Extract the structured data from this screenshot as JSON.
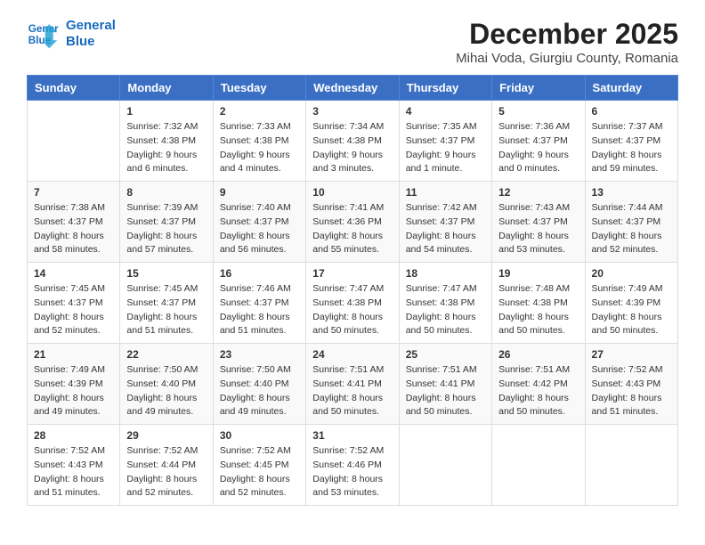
{
  "logo": {
    "line1": "General",
    "line2": "Blue"
  },
  "title": "December 2025",
  "subtitle": "Mihai Voda, Giurgiu County, Romania",
  "days_of_week": [
    "Sunday",
    "Monday",
    "Tuesday",
    "Wednesday",
    "Thursday",
    "Friday",
    "Saturday"
  ],
  "weeks": [
    [
      {
        "day": "",
        "info": ""
      },
      {
        "day": "1",
        "info": "Sunrise: 7:32 AM\nSunset: 4:38 PM\nDaylight: 9 hours\nand 6 minutes."
      },
      {
        "day": "2",
        "info": "Sunrise: 7:33 AM\nSunset: 4:38 PM\nDaylight: 9 hours\nand 4 minutes."
      },
      {
        "day": "3",
        "info": "Sunrise: 7:34 AM\nSunset: 4:38 PM\nDaylight: 9 hours\nand 3 minutes."
      },
      {
        "day": "4",
        "info": "Sunrise: 7:35 AM\nSunset: 4:37 PM\nDaylight: 9 hours\nand 1 minute."
      },
      {
        "day": "5",
        "info": "Sunrise: 7:36 AM\nSunset: 4:37 PM\nDaylight: 9 hours\nand 0 minutes."
      },
      {
        "day": "6",
        "info": "Sunrise: 7:37 AM\nSunset: 4:37 PM\nDaylight: 8 hours\nand 59 minutes."
      }
    ],
    [
      {
        "day": "7",
        "info": "Sunrise: 7:38 AM\nSunset: 4:37 PM\nDaylight: 8 hours\nand 58 minutes."
      },
      {
        "day": "8",
        "info": "Sunrise: 7:39 AM\nSunset: 4:37 PM\nDaylight: 8 hours\nand 57 minutes."
      },
      {
        "day": "9",
        "info": "Sunrise: 7:40 AM\nSunset: 4:37 PM\nDaylight: 8 hours\nand 56 minutes."
      },
      {
        "day": "10",
        "info": "Sunrise: 7:41 AM\nSunset: 4:36 PM\nDaylight: 8 hours\nand 55 minutes."
      },
      {
        "day": "11",
        "info": "Sunrise: 7:42 AM\nSunset: 4:37 PM\nDaylight: 8 hours\nand 54 minutes."
      },
      {
        "day": "12",
        "info": "Sunrise: 7:43 AM\nSunset: 4:37 PM\nDaylight: 8 hours\nand 53 minutes."
      },
      {
        "day": "13",
        "info": "Sunrise: 7:44 AM\nSunset: 4:37 PM\nDaylight: 8 hours\nand 52 minutes."
      }
    ],
    [
      {
        "day": "14",
        "info": "Sunrise: 7:45 AM\nSunset: 4:37 PM\nDaylight: 8 hours\nand 52 minutes."
      },
      {
        "day": "15",
        "info": "Sunrise: 7:45 AM\nSunset: 4:37 PM\nDaylight: 8 hours\nand 51 minutes."
      },
      {
        "day": "16",
        "info": "Sunrise: 7:46 AM\nSunset: 4:37 PM\nDaylight: 8 hours\nand 51 minutes."
      },
      {
        "day": "17",
        "info": "Sunrise: 7:47 AM\nSunset: 4:38 PM\nDaylight: 8 hours\nand 50 minutes."
      },
      {
        "day": "18",
        "info": "Sunrise: 7:47 AM\nSunset: 4:38 PM\nDaylight: 8 hours\nand 50 minutes."
      },
      {
        "day": "19",
        "info": "Sunrise: 7:48 AM\nSunset: 4:38 PM\nDaylight: 8 hours\nand 50 minutes."
      },
      {
        "day": "20",
        "info": "Sunrise: 7:49 AM\nSunset: 4:39 PM\nDaylight: 8 hours\nand 50 minutes."
      }
    ],
    [
      {
        "day": "21",
        "info": "Sunrise: 7:49 AM\nSunset: 4:39 PM\nDaylight: 8 hours\nand 49 minutes."
      },
      {
        "day": "22",
        "info": "Sunrise: 7:50 AM\nSunset: 4:40 PM\nDaylight: 8 hours\nand 49 minutes."
      },
      {
        "day": "23",
        "info": "Sunrise: 7:50 AM\nSunset: 4:40 PM\nDaylight: 8 hours\nand 49 minutes."
      },
      {
        "day": "24",
        "info": "Sunrise: 7:51 AM\nSunset: 4:41 PM\nDaylight: 8 hours\nand 50 minutes."
      },
      {
        "day": "25",
        "info": "Sunrise: 7:51 AM\nSunset: 4:41 PM\nDaylight: 8 hours\nand 50 minutes."
      },
      {
        "day": "26",
        "info": "Sunrise: 7:51 AM\nSunset: 4:42 PM\nDaylight: 8 hours\nand 50 minutes."
      },
      {
        "day": "27",
        "info": "Sunrise: 7:52 AM\nSunset: 4:43 PM\nDaylight: 8 hours\nand 51 minutes."
      }
    ],
    [
      {
        "day": "28",
        "info": "Sunrise: 7:52 AM\nSunset: 4:43 PM\nDaylight: 8 hours\nand 51 minutes."
      },
      {
        "day": "29",
        "info": "Sunrise: 7:52 AM\nSunset: 4:44 PM\nDaylight: 8 hours\nand 52 minutes."
      },
      {
        "day": "30",
        "info": "Sunrise: 7:52 AM\nSunset: 4:45 PM\nDaylight: 8 hours\nand 52 minutes."
      },
      {
        "day": "31",
        "info": "Sunrise: 7:52 AM\nSunset: 4:46 PM\nDaylight: 8 hours\nand 53 minutes."
      },
      {
        "day": "",
        "info": ""
      },
      {
        "day": "",
        "info": ""
      },
      {
        "day": "",
        "info": ""
      }
    ]
  ]
}
